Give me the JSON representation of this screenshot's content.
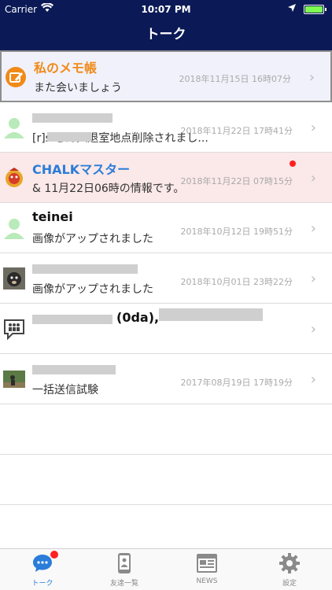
{
  "status_bar": {
    "carrier": "Carrier",
    "time": "10:07 PM"
  },
  "header": {
    "title": "トーク"
  },
  "rows": [
    {
      "name": "私のメモ帳",
      "message": "また会いましょう",
      "timestamp": "2018年11月15日 16時07分"
    },
    {
      "name": "",
      "message": "[r]s          さん入退室地点削除されまし...",
      "timestamp": "2018年11月22日 17時41分"
    },
    {
      "name": "CHALKマスター",
      "message": "& 11月22日06時の情報です。",
      "timestamp": "2018年11月22日 07時15分"
    },
    {
      "name": "teinei",
      "message": "画像がアップされました",
      "timestamp": "2018年10月12日 19時51分"
    },
    {
      "name": "",
      "message": "画像がアップされました",
      "timestamp": "2018年10月01日 23時22分"
    },
    {
      "name": "(0da),",
      "message": "",
      "timestamp": ""
    },
    {
      "name": "",
      "message": "一括送信試験",
      "timestamp": "2017年08月19日 17時19分"
    }
  ],
  "tabs": [
    {
      "label": "トーク"
    },
    {
      "label": "友達一覧"
    },
    {
      "label": "NEWS"
    },
    {
      "label": "設定"
    }
  ],
  "colors": {
    "header": "#0b1a56",
    "memo_name": "#f08a19",
    "chalk_name": "#2a7dd8",
    "chalk_bg": "#fbe8e8",
    "badge": "#ff2020"
  }
}
